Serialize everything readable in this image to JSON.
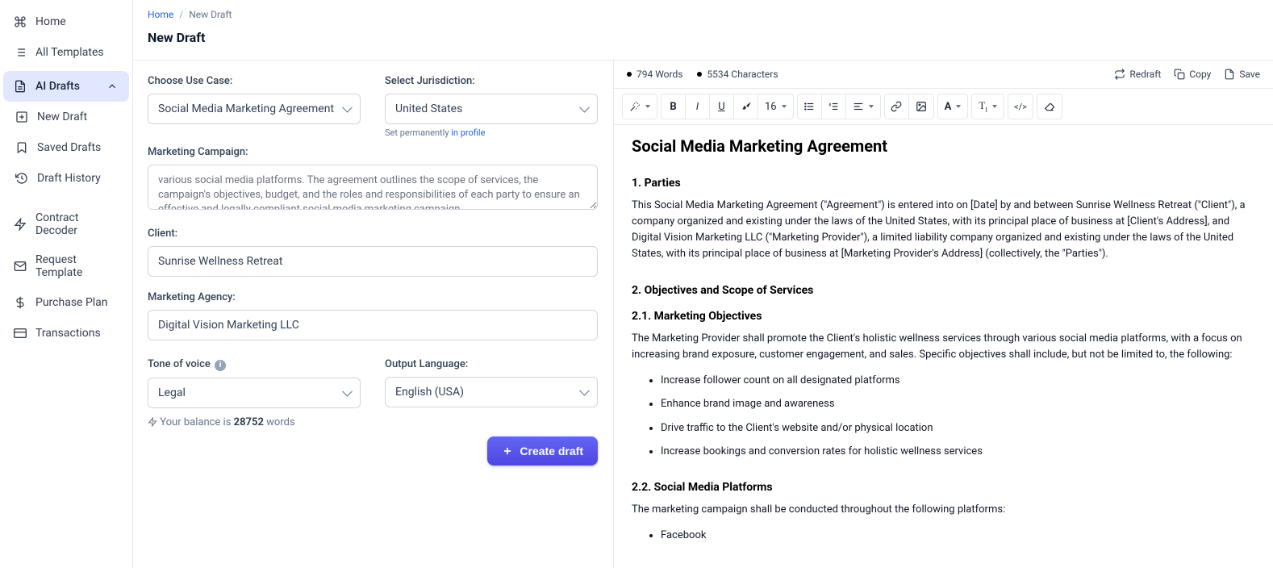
{
  "sidebar": {
    "items": [
      {
        "label": "Home"
      },
      {
        "label": "All Templates"
      },
      {
        "label": "AI Drafts"
      },
      {
        "label": "New Draft"
      },
      {
        "label": "Saved Drafts"
      },
      {
        "label": "Draft History"
      },
      {
        "label": "Contract Decoder"
      },
      {
        "label": "Request Template"
      },
      {
        "label": "Purchase Plan"
      },
      {
        "label": "Transactions"
      }
    ]
  },
  "breadcrumb": {
    "home": "Home",
    "sep": "/",
    "current": "New Draft"
  },
  "page_title": "New Draft",
  "form": {
    "use_case_label": "Choose Use Case:",
    "use_case_value": "Social Media Marketing Agreement",
    "jurisdiction_label": "Select Jurisdiction:",
    "jurisdiction_value": "United States",
    "jurisdiction_helper_pre": "Set permanently ",
    "jurisdiction_helper_link": "in profile",
    "campaign_label": "Marketing Campaign:",
    "campaign_value": "various social media platforms. The agreement outlines the scope of services, the campaign's objectives, budget, and the roles and responsibilities of each party to ensure an effective and legally compliant social media marketing campaign.",
    "client_label": "Client:",
    "client_value": "Sunrise Wellness Retreat",
    "agency_label": "Marketing Agency:",
    "agency_value": "Digital Vision Marketing LLC",
    "tone_label": "Tone of voice ",
    "tone_value": "Legal",
    "outlang_label": "Output Language:",
    "outlang_value": "English (USA)",
    "balance_pre": "Your balance is ",
    "balance_num": "28752",
    "balance_post": " words",
    "create_btn": "Create draft"
  },
  "output": {
    "words": "794 Words",
    "chars": "5534 Characters",
    "redraft": "Redraft",
    "copy": "Copy",
    "save": "Save",
    "font_size": "16"
  },
  "doc": {
    "title": "Social Media Marketing Agreement",
    "h1": "1. Parties",
    "p1": "This Social Media Marketing Agreement (\"Agreement\") is entered into on [Date] by and between Sunrise Wellness Retreat (\"Client\"), a company organized and existing under the laws of the United States, with its principal place of business at [Client's Address], and Digital Vision Marketing LLC (\"Marketing Provider\"), a limited liability company organized and existing under the laws of the United States, with its principal place of business at [Marketing Provider's Address] (collectively, the \"Parties\").",
    "h2": "2. Objectives and Scope of Services",
    "h21": "2.1. Marketing Objectives",
    "p2": "The Marketing Provider shall promote the Client's holistic wellness services through various social media platforms, with a focus on increasing brand exposure, customer engagement, and sales. Specific objectives shall include, but not be limited to, the following:",
    "li1": "Increase follower count on all designated platforms",
    "li2": "Enhance brand image and awareness",
    "li3": "Drive traffic to the Client's website and/or physical location",
    "li4": "Increase bookings and conversion rates for holistic wellness services",
    "h22": "2.2. Social Media Platforms",
    "p3": "The marketing campaign shall be conducted throughout the following platforms:",
    "li5": "Facebook"
  }
}
